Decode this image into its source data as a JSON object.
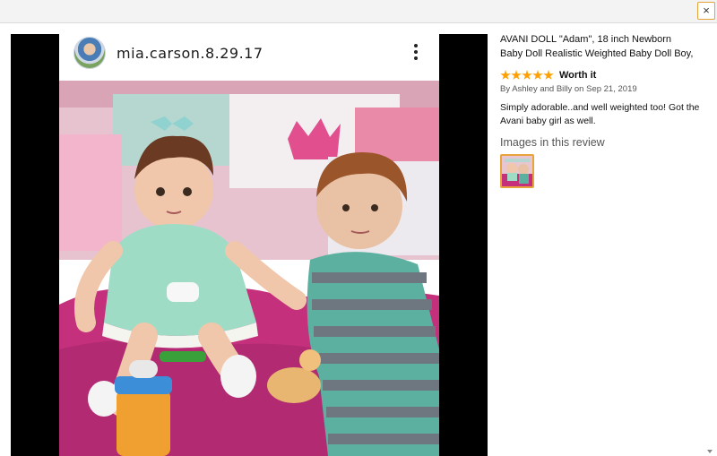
{
  "window": {
    "close_label": "×"
  },
  "post": {
    "username": "mia.carson.8.29.17"
  },
  "review": {
    "product_title_line1": "AVANI DOLL \"Adam\", 18 inch Newborn",
    "product_title_line2": "Baby Doll Realistic Weighted Baby Doll Boy,",
    "stars": 5,
    "headline": "Worth it",
    "byline": "By Ashley and Billy on Sep 21, 2019",
    "body_line1": "Simply adorable..and well weighted too! Got the",
    "body_line2": "Avani baby girl as well.",
    "images_heading": "Images in this review"
  },
  "colors": {
    "star": "#ff9f00",
    "thumb_border": "#e8a43a"
  }
}
